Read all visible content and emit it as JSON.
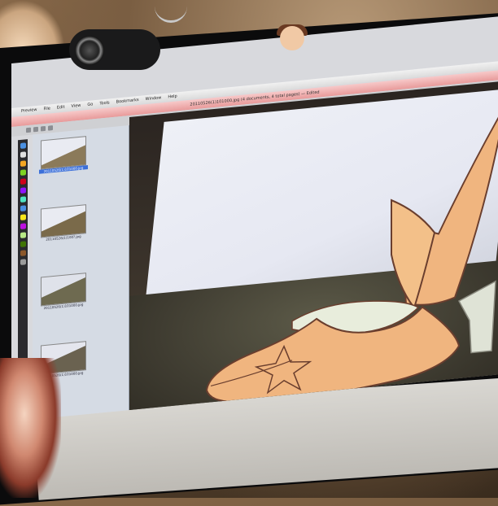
{
  "menubar": {
    "app": "Preview",
    "items": [
      "File",
      "Edit",
      "View",
      "Go",
      "Tools",
      "Bookmarks",
      "Window",
      "Help"
    ]
  },
  "window": {
    "title": "20110526(1)101000.jpg (4 documents, 4 total pages) — Edited"
  },
  "sidebar": {
    "thumbnails": [
      {
        "label": "20110526(1)101000.jpg",
        "selected": true
      },
      {
        "label": "20110526(1)100?.jpg",
        "selected": false
      },
      {
        "label": "20110526(1)101000.jpg",
        "selected": false
      },
      {
        "label": "20110526(1)101000.jpg",
        "selected": false
      }
    ]
  },
  "colors": {
    "shoe_body": "#f0b57f",
    "shoe_outline": "#6a3e2e",
    "shoe_lining": "#e8eddc",
    "selection": "#3b6fd9"
  },
  "icons": [
    "apple-logo-icon",
    "webcam-icon"
  ]
}
